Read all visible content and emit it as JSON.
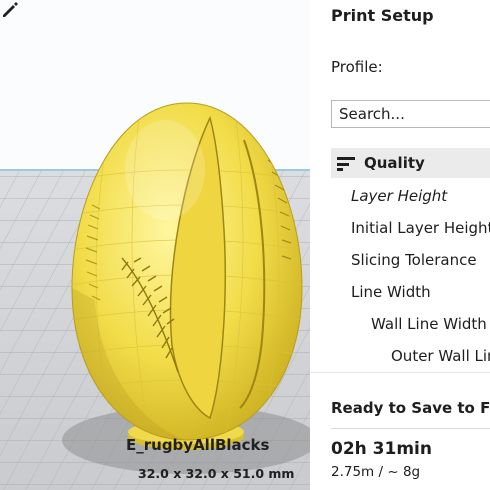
{
  "viewport": {
    "model_name": "E_rugbyAllBlacks",
    "model_dimensions": "32.0 x 32.0 x 51.0 mm",
    "edit_icon": "pencil-icon",
    "model_color": "#f5e04a"
  },
  "print_setup": {
    "title": "Print Setup",
    "profile_label": "Profile:",
    "search_placeholder": "Search...",
    "section": {
      "icon": "sliders-icon",
      "label": "Quality"
    },
    "settings": [
      "Layer Height",
      "Initial Layer Height",
      "Slicing Tolerance",
      "Line Width",
      "Wall Line Width",
      "Outer Wall Line Width"
    ]
  },
  "status": {
    "ready_text": "Ready to Save to File",
    "print_time": "02h 31min",
    "material": "2.75m / ~ 8g"
  }
}
